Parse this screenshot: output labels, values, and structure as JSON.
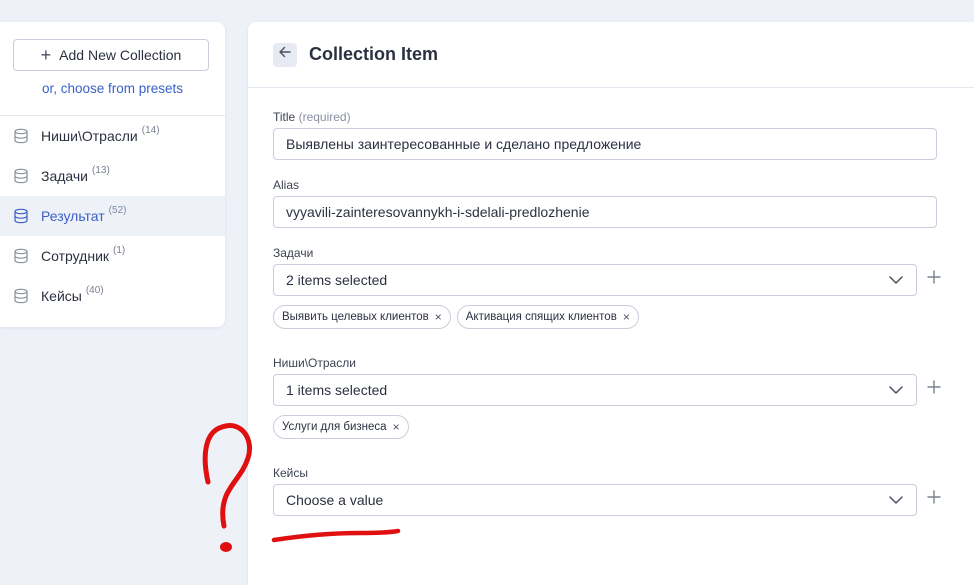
{
  "sidebar": {
    "add_button_label": "Add New Collection",
    "presets_link": "or, choose from presets",
    "collections": [
      {
        "label": "Ниши\\Отрасли",
        "count": "(14)",
        "active": false
      },
      {
        "label": "Задачи",
        "count": "(13)",
        "active": false
      },
      {
        "label": "Результат",
        "count": "(52)",
        "active": true
      },
      {
        "label": "Сотрудник",
        "count": "(1)",
        "active": false
      },
      {
        "label": "Кейсы",
        "count": "(40)",
        "active": false
      }
    ]
  },
  "main": {
    "title": "Collection Item",
    "fields": {
      "title": {
        "label": "Title",
        "required_note": "(required)",
        "value": "Выявлены заинтересованные и сделано предложение"
      },
      "alias": {
        "label": "Alias",
        "value": "vyyavili-zainteresovannykh-i-sdelali-predlozhenie"
      },
      "zadachi": {
        "label": "Задачи",
        "value": "2 items selected",
        "chips": [
          "Выявить целевых клиентов",
          "Активация спящих клиентов"
        ]
      },
      "nishi": {
        "label": "Ниши\\Отрасли",
        "value": "1 items selected",
        "chips": [
          "Услуги для бизнеса"
        ]
      },
      "keysy": {
        "label": "Кейсы",
        "value": "Choose a value"
      }
    }
  },
  "colors": {
    "accent": "#3a5fc8",
    "background": "#eef1f8",
    "annotation": "#e01010"
  },
  "icons": {
    "collection": "database-icon",
    "back": "arrow-left-icon",
    "dropdown": "chevron-down-icon",
    "add": "plus-icon",
    "remove": "close-icon"
  }
}
